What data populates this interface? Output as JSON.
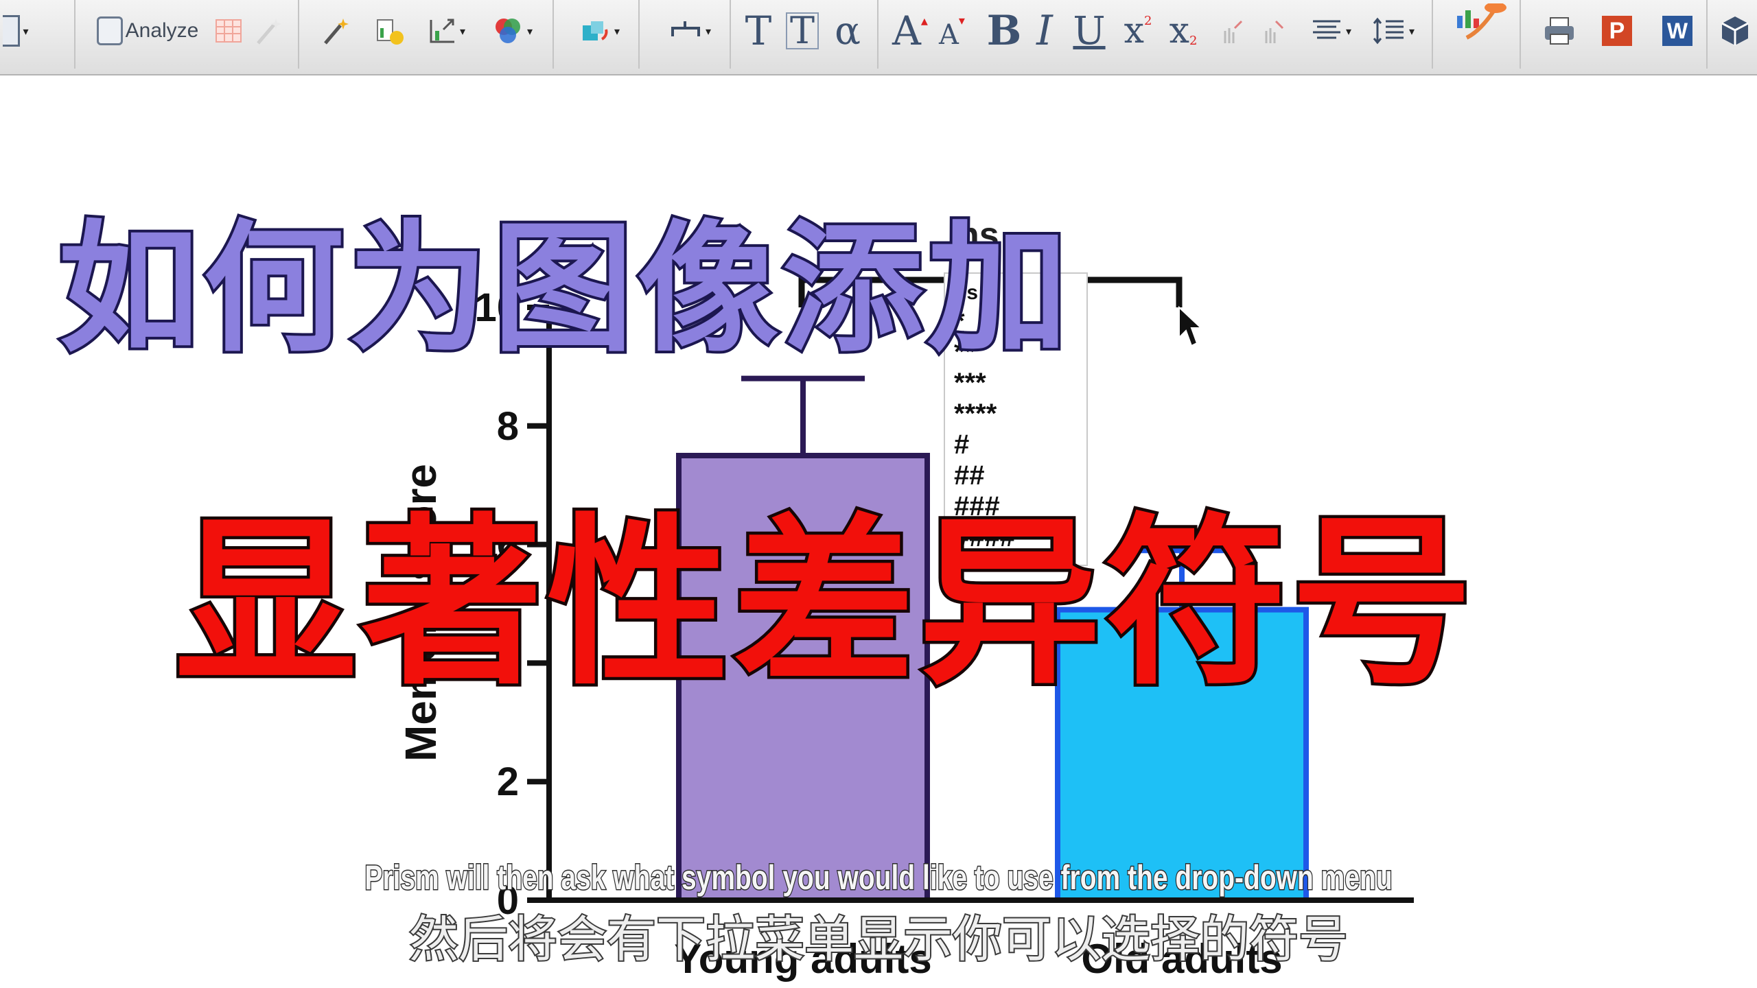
{
  "toolbar": {
    "analyze_label": "Analyze",
    "text_T1": "T",
    "text_T2": "T",
    "alpha": "α",
    "font_larger": "A",
    "font_smaller": "A",
    "bold": "B",
    "italic": "I",
    "underline": "U",
    "superscript": "x",
    "superscript_mark": "2",
    "subscript": "x",
    "subscript_mark": "2",
    "powerpoint": "P",
    "word": "W",
    "icons": [
      "clipboard-icon",
      "analyze-icon",
      "table-icon",
      "magic-wand-icon",
      "wand-sparkle-icon",
      "add-data-icon",
      "graph-axes-icon",
      "color-palette-icon",
      "rotate-icon",
      "connector-icon",
      "text-icon",
      "text-box-icon",
      "greek-icon",
      "font-larger-icon",
      "font-smaller-icon",
      "bold-icon",
      "italic-icon",
      "underline-icon",
      "superscript-icon",
      "subscript-icon",
      "bring-forward-icon",
      "send-backward-icon",
      "align-icon",
      "line-spacing-icon",
      "drop-icon",
      "print-icon",
      "powerpoint-icon",
      "word-icon",
      "cube-icon"
    ]
  },
  "chart_data": {
    "type": "bar",
    "categories": [
      "Young adults",
      "Old adults"
    ],
    "values": [
      7.5,
      4.9
    ],
    "errors": [
      1.3,
      1.0
    ],
    "colors": [
      "#a28ad0",
      "#1ec0f6"
    ],
    "edge_colors": [
      "#2b1a55",
      "#1e58e8"
    ],
    "ylabel": "Memory score",
    "ylim": [
      0,
      10
    ],
    "yticks": [
      0,
      2,
      4,
      6,
      8,
      10
    ],
    "significance_header": "ns"
  },
  "symbol_menu": {
    "items": [
      "ns",
      "*",
      "**",
      "***",
      "****",
      "#",
      "##",
      "###",
      "####"
    ]
  },
  "overlay": {
    "title_line1": "如何为图像添加",
    "title_line2": "显著性差异符号",
    "subtitle_en": "Prism will then ask what symbol you would like to use from the drop-down menu",
    "subtitle_zh": "然后将会有下拉菜单显示你可以选择的符号"
  }
}
